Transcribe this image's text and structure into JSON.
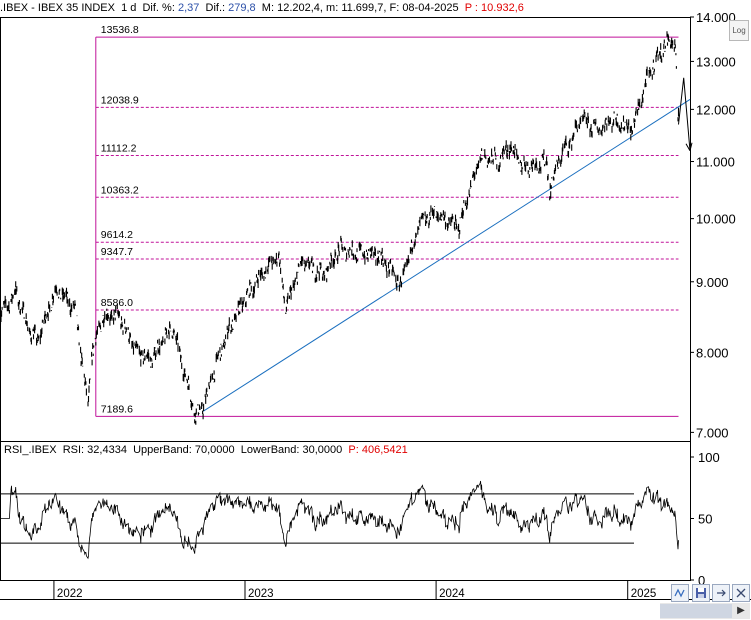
{
  "header": {
    "symbol": ".IBEX - IBEX 35 INDEX",
    "interval": "1 d",
    "dif_pct_label": "Dif. %:",
    "dif_pct": "2,37",
    "dif_label": "Dif.:",
    "dif": "279,8",
    "m_label": "M:",
    "m": "12.202,4",
    "min_label": "m:",
    "min": "11.699,7",
    "f_label": "F:",
    "f": "08-04-2025",
    "p_label": "P :",
    "p": "10.932,6"
  },
  "log_button": "Log",
  "rsi_header": {
    "name": "RSI_.IBEX",
    "rsi_label": "RSI:",
    "rsi": "32,4334",
    "upper_label": "UpperBand:",
    "upper": "70,0000",
    "lower_label": "LowerBand:",
    "lower": "30,0000",
    "p_label": "P:",
    "p": "406,5421"
  },
  "colors": {
    "price": "#000000",
    "fib": "#c0129a",
    "trend": "#1a6fbf",
    "rsi_overbought": "#3a6fc0",
    "rsi_oversold": "#e02020",
    "last_red": "#e00000"
  },
  "chart_data": [
    {
      "type": "line",
      "name": "IBEX 35 INDEX daily",
      "scale": "log",
      "x_range": [
        "2021-09-20",
        "2025-04-30"
      ],
      "ylim": [
        6900,
        14000
      ],
      "y_ticks": [
        "14.000",
        "13.000",
        "12.000",
        "11.000",
        "10.000",
        "9.000",
        "8.000",
        "7.000"
      ],
      "x_ticks": [
        "2022",
        "2023",
        "2024",
        "2025"
      ],
      "series": [
        {
          "x": [
            "2021-09-20",
            "2021-10-20",
            "2021-11-15",
            "2021-12-01",
            "2022-01-05",
            "2022-02-10",
            "2022-03-07",
            "2022-03-15",
            "2022-04-05",
            "2022-05-05",
            "2022-06-08",
            "2022-07-06",
            "2022-08-15",
            "2022-09-29",
            "2022-10-13",
            "2022-11-10",
            "2022-12-01",
            "2023-01-06",
            "2023-02-10",
            "2023-03-06",
            "2023-03-20",
            "2023-04-20",
            "2023-05-31",
            "2023-06-30",
            "2023-07-31",
            "2023-09-15",
            "2023-10-26",
            "2023-11-30",
            "2023-12-29",
            "2024-02-13",
            "2024-03-27",
            "2024-04-30",
            "2024-05-20",
            "2024-06-14",
            "2024-07-30",
            "2024-08-05",
            "2024-08-30",
            "2024-09-10",
            "2024-10-04",
            "2024-11-05",
            "2024-12-03",
            "2025-01-10",
            "2025-02-10",
            "2025-03-03",
            "2025-03-26",
            "2025-04-02",
            "2025-04-07",
            "2025-04-08"
          ],
          "y": [
            8500,
            8850,
            8300,
            8150,
            8900,
            8600,
            7300,
            8000,
            8500,
            8500,
            8000,
            7900,
            8350,
            7190,
            7300,
            7900,
            8300,
            8800,
            9200,
            9400,
            8600,
            9300,
            9100,
            9500,
            9450,
            9400,
            8950,
            9900,
            10100,
            9850,
            11100,
            11000,
            11300,
            10900,
            11000,
            10500,
            11200,
            11300,
            11800,
            11600,
            11800,
            11600,
            12700,
            13200,
            13500,
            13300,
            11700,
            11950
          ]
        }
      ],
      "fibonacci_levels": [
        {
          "label": "13536.8",
          "value": 13536.8
        },
        {
          "label": "12038.9",
          "value": 12038.9
        },
        {
          "label": "11112.2",
          "value": 11112.2
        },
        {
          "label": "10363.2",
          "value": 10363.2
        },
        {
          "label": "9614.2",
          "value": 9614.2
        },
        {
          "label": "9347.7",
          "value": 9347.7
        },
        {
          "label": "8586.0",
          "value": 8586.0
        },
        {
          "label": "7189.6",
          "value": 7189.6
        }
      ],
      "trendline": {
        "x": [
          "2022-10-13",
          "2025-04-30"
        ],
        "y": [
          7250,
          12200
        ]
      },
      "projection": {
        "x": [
          "2025-04-08",
          "2025-04-18",
          "2025-04-30"
        ],
        "y": [
          11700,
          12650,
          11200
        ]
      }
    },
    {
      "type": "line",
      "name": "RSI",
      "ylim": [
        0,
        100
      ],
      "y_ticks": [
        "100",
        "50",
        "0"
      ],
      "bands": {
        "upper": 70,
        "lower": 30
      },
      "last_value": 32.4334
    }
  ]
}
